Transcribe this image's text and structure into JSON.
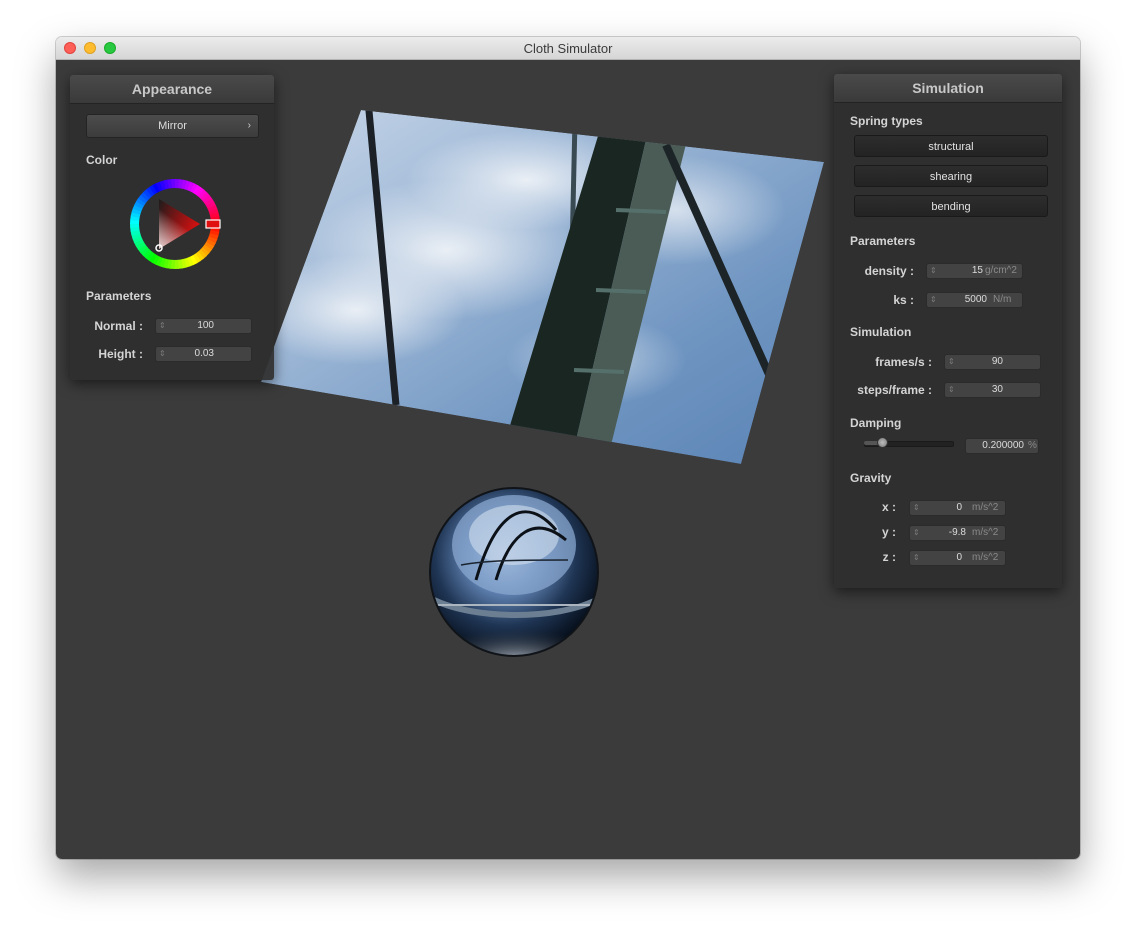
{
  "window": {
    "title": "Cloth Simulator"
  },
  "appearance": {
    "title": "Appearance",
    "shader": "Mirror",
    "color_label": "Color",
    "selected_hue": "#e01010",
    "parameters_label": "Parameters",
    "params": [
      {
        "label": "Normal :",
        "value": "100"
      },
      {
        "label": "Height :",
        "value": "0.03"
      }
    ]
  },
  "simulation": {
    "title": "Simulation",
    "spring_types_label": "Spring types",
    "spring_types": [
      "structural",
      "shearing",
      "bending"
    ],
    "parameters_label": "Parameters",
    "params": [
      {
        "label": "density :",
        "value": "15",
        "unit": "g/cm^2"
      },
      {
        "label": "ks :",
        "value": "5000",
        "unit": "N/m"
      }
    ],
    "simulation_label": "Simulation",
    "sim_params": [
      {
        "label": "frames/s :",
        "value": "90"
      },
      {
        "label": "steps/frame :",
        "value": "30"
      }
    ],
    "damping_label": "Damping",
    "damping": {
      "value": "0.200000",
      "unit": "%",
      "slider_fraction": 0.2
    },
    "gravity_label": "Gravity",
    "gravity": [
      {
        "label": "x :",
        "value": "0",
        "unit": "m/s^2"
      },
      {
        "label": "y :",
        "value": "-9.8",
        "unit": "m/s^2"
      },
      {
        "label": "z :",
        "value": "0",
        "unit": "m/s^2"
      }
    ]
  },
  "colors": {
    "viewport_bg": "#3b3b3b",
    "panel_bg": "#2e2e2e",
    "sky": "#7a9fc8"
  }
}
